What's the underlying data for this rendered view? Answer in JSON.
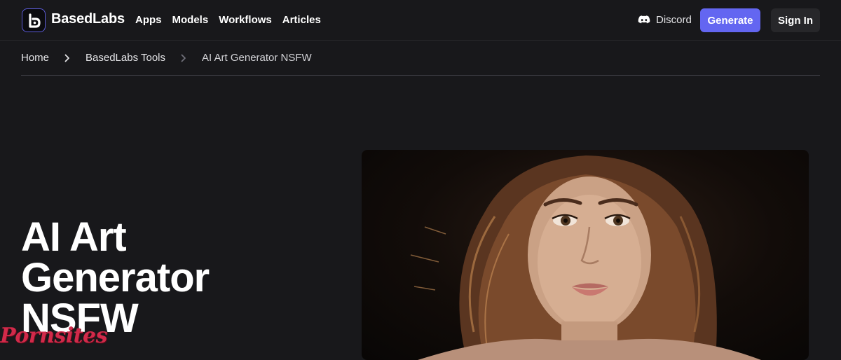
{
  "header": {
    "brand": "BasedLabs",
    "nav_links": [
      "Apps",
      "Models",
      "Workflows",
      "Articles"
    ],
    "discord_label": "Discord",
    "generate_label": "Generate",
    "signin_label": "Sign In"
  },
  "breadcrumb": [
    "Home",
    "BasedLabs Tools",
    "AI Art Generator NSFW"
  ],
  "hero": {
    "title_lines": [
      "AI Art",
      "Generator",
      "NSFW"
    ]
  },
  "watermark": "Pornsites",
  "colors": {
    "background": "#18181b",
    "accent": "#6366f1",
    "secondary_button": "#27272a",
    "watermark": "#d12a4a"
  },
  "icons": [
    "basedlabs-logo-icon",
    "discord-icon",
    "chevron-right-icon"
  ]
}
